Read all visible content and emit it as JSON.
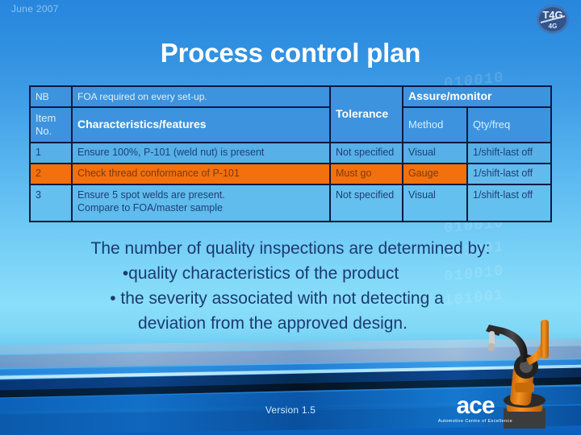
{
  "slide": {
    "date_stamp": "June 2007",
    "title": "Process control plan",
    "version": "Version 1.5"
  },
  "logos": {
    "top_right": {
      "name": "t4g-logo",
      "text": "T4G"
    },
    "bottom_right": {
      "name": "ace-logo",
      "word": "ace",
      "tagline": "Automotive Centre of Excellence"
    }
  },
  "decor": {
    "binary_watermark": "010010\n101001\n010010\n101001\n010010\n101001\n010010\n101001\n010010\n101001"
  },
  "table": {
    "header_top": {
      "item_no": "NB",
      "characteristics": "FOA required on every set-up.",
      "tolerance": "Tolerance",
      "assure_monitor": "Assure/monitor"
    },
    "header_bottom": {
      "item_no": "Item No.",
      "characteristics": "Characteristics/features",
      "method": "Method",
      "qty_freq": "Qty/freq"
    },
    "rows": [
      {
        "item_no": "1",
        "characteristics": "Ensure 100%, P-101 (weld nut) is present",
        "tolerance": "Not specified",
        "method": "Visual",
        "qty_freq": "1/shift-last off",
        "highlight": "none"
      },
      {
        "item_no": "2",
        "characteristics": "Check thread conformance of P-101",
        "tolerance": "Must go",
        "method": "Gauge",
        "qty_freq": "1/shift-last off",
        "highlight": "orange"
      },
      {
        "item_no": "3",
        "characteristics": "Ensure 5 spot welds are present.\nCompare to FOA/master sample",
        "tolerance": "Not specified",
        "method": "Visual",
        "qty_freq": "1/shift-last off",
        "highlight": "none"
      }
    ]
  },
  "body": {
    "lines": [
      "The number of quality inspections are determined by:",
      "•quality characteristics of the product",
      "• the severity associated with not detecting a",
      "deviation from the approved design."
    ]
  },
  "colors": {
    "background_top": "#2886dd",
    "background_mid": "#8adef9",
    "background_bottom": "#0a5ebb",
    "table_cell": "#3d93dd",
    "table_border": "#0c1a40",
    "highlight_orange": "#f4700c",
    "body_text": "#1b3a72",
    "title_text": "#ffffff",
    "robot_arm": "#e8820f"
  }
}
